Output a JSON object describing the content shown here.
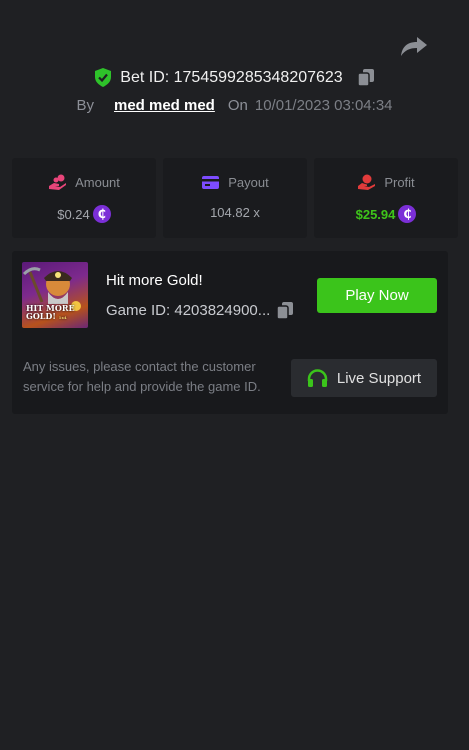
{
  "bet": {
    "id_label": "Bet ID: 1754599285348207623",
    "by_label": "By",
    "username": "med med med",
    "on_label": "On",
    "datetime": "10/01/2023 03:04:34"
  },
  "stats": {
    "amount": {
      "label": "Amount",
      "value": "$0.24",
      "icon": "hand-coins-icon"
    },
    "payout": {
      "label": "Payout",
      "value": "104.82 x",
      "icon": "card-icon"
    },
    "profit": {
      "label": "Profit",
      "value": "$25.94",
      "icon": "hand-money-icon"
    }
  },
  "coin_symbol": "₵",
  "game": {
    "title": "Hit more Gold!",
    "id_label": "Game ID: 4203824900...",
    "thumbnail_text": "HIT MORE GOLD!",
    "thumbnail_subtext": "1x4",
    "play_label": "Play Now",
    "issues_text": "Any issues, please contact the customer service for help and provide the game ID.",
    "support_label": "Live Support"
  },
  "colors": {
    "background": "#1f2023",
    "card": "#1a1b1e",
    "accent_green": "#3bc41b",
    "shield_green": "#2ec22a",
    "coin_purple": "#7b2fd7",
    "amount_icon": "#e8457a",
    "payout_icon": "#7d4cff",
    "profit_icon": "#e23b3b"
  }
}
